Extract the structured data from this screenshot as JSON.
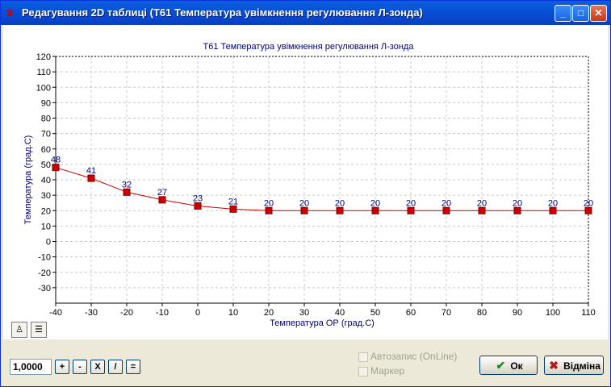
{
  "window": {
    "title": "Редагування 2D таблиці (T61 Температура увімкнення регулювання Л-зонда)",
    "minimize_label": "_",
    "maximize_label": "□",
    "close_label": "✕"
  },
  "chart_data": {
    "type": "line",
    "title": "T61 Температура увімкнення регулювання Л-зонда",
    "xlabel": "Температура ОР (град.С)",
    "ylabel": "Температура (град.С)",
    "x": [
      -40,
      -30,
      -20,
      -10,
      0,
      10,
      20,
      30,
      40,
      50,
      60,
      70,
      80,
      90,
      100,
      110
    ],
    "values": [
      48,
      41,
      32,
      27,
      23,
      21,
      20,
      20,
      20,
      20,
      20,
      20,
      20,
      20,
      20,
      20
    ],
    "point_labels": [
      "48",
      "41",
      "32",
      "27",
      "23",
      "21",
      "20",
      "20",
      "20",
      "20",
      "20",
      "20",
      "20",
      "20",
      "20",
      "20"
    ],
    "xlim": [
      -40,
      110
    ],
    "ylim": [
      -40,
      120
    ],
    "xticks": [
      "-40",
      "-30",
      "-20",
      "-10",
      "0",
      "10",
      "20",
      "30",
      "40",
      "50",
      "60",
      "70",
      "80",
      "90",
      "100",
      "110"
    ],
    "yticks": [
      "120",
      "110",
      "100",
      "90",
      "80",
      "70",
      "60",
      "50",
      "40",
      "30",
      "20",
      "10",
      "0",
      "-10",
      "-20",
      "-30"
    ],
    "line_color": "#cc0000",
    "marker_color": "#cc0000",
    "label_color": "#000080",
    "grid": true
  },
  "toolbar": {
    "value": "1,0000",
    "plus_label": "+",
    "minus_label": "-",
    "multiply_label": "X",
    "divide_label": "/",
    "equals_label": "="
  },
  "options": {
    "autosave_label": "Автозапис (OnLine)",
    "marker_label": "Маркер"
  },
  "buttons": {
    "ok_label": "Ок",
    "cancel_label": "Відміна"
  }
}
